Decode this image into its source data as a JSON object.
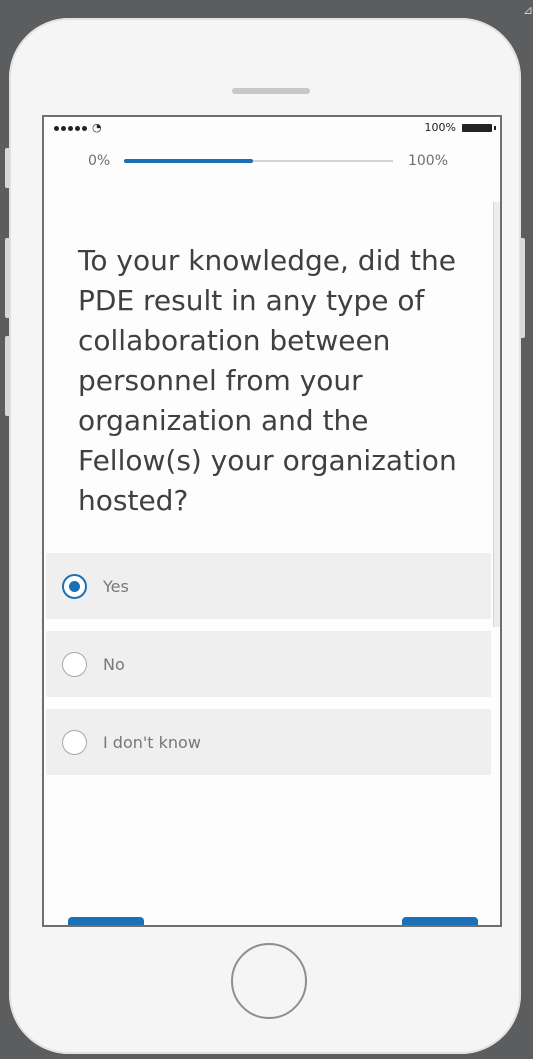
{
  "status_bar": {
    "signal": "•••••",
    "wifi_icon": "wifi-icon",
    "battery_text": "100%",
    "battery_icon": "battery-icon"
  },
  "progress": {
    "start_label": "0%",
    "end_label": "100%",
    "value": 0.48,
    "accent_color": "#1b70b7"
  },
  "question": {
    "text": "To your knowledge, did the PDE result in any type of collaboration between personnel from your organization and the Fellow(s) your organization hosted?"
  },
  "options": [
    {
      "label": "Yes",
      "selected": true
    },
    {
      "label": "No",
      "selected": false
    },
    {
      "label": "I don't know",
      "selected": false
    }
  ]
}
